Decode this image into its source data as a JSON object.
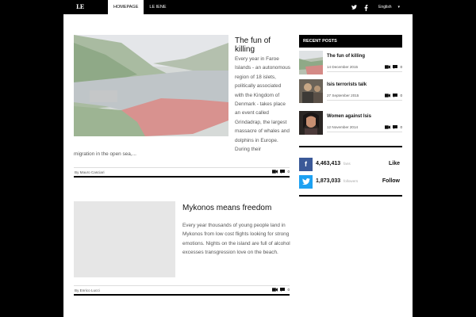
{
  "header": {
    "logo_text": "LE IENE",
    "nav": [
      {
        "label": "HOMEPAGE",
        "active": true
      },
      {
        "label": "LE IENE",
        "active": false
      }
    ],
    "language": "English",
    "social_icons": [
      "twitter-icon",
      "facebook-icon"
    ]
  },
  "articles": [
    {
      "title": "The fun of killing",
      "text": "Every year in Faroe Islands - an autonomous region of 18 islets, politically associated with the Kingdom of Denmark - takes place an event called Grindadrap, the largest massacre of whales and dolphins in Europe. During their",
      "text_tail": "migration in the open sea,...",
      "author": "By Mauro Casciari",
      "comments": "0"
    },
    {
      "title": "Mykonos means freedom",
      "text": "Every year thousands of young people land in Mykonos from low cost flights looking for strong emotions. Nights on the island are full of alcohol excesses transgression love on the beach.",
      "author": "By Enrico Lucci",
      "comments": "0"
    }
  ],
  "sidebar": {
    "heading": "RECENT POSTS",
    "posts": [
      {
        "title": "The fun of killing",
        "date": "14 December 2015",
        "comments": "0"
      },
      {
        "title": "Isis terrorists talk",
        "date": "27 September 2015",
        "comments": "0"
      },
      {
        "title": "Women against Isis",
        "date": "12 November 2014",
        "comments": "0"
      }
    ]
  },
  "social": {
    "facebook": {
      "count": "4,463,413",
      "unit": "fans",
      "action": "Like",
      "icon": "facebook-icon",
      "color": "#3b5998"
    },
    "twitter": {
      "count": "1,873,033",
      "unit": "followers",
      "action": "Follow",
      "icon": "twitter-icon",
      "color": "#1da1f2"
    }
  }
}
